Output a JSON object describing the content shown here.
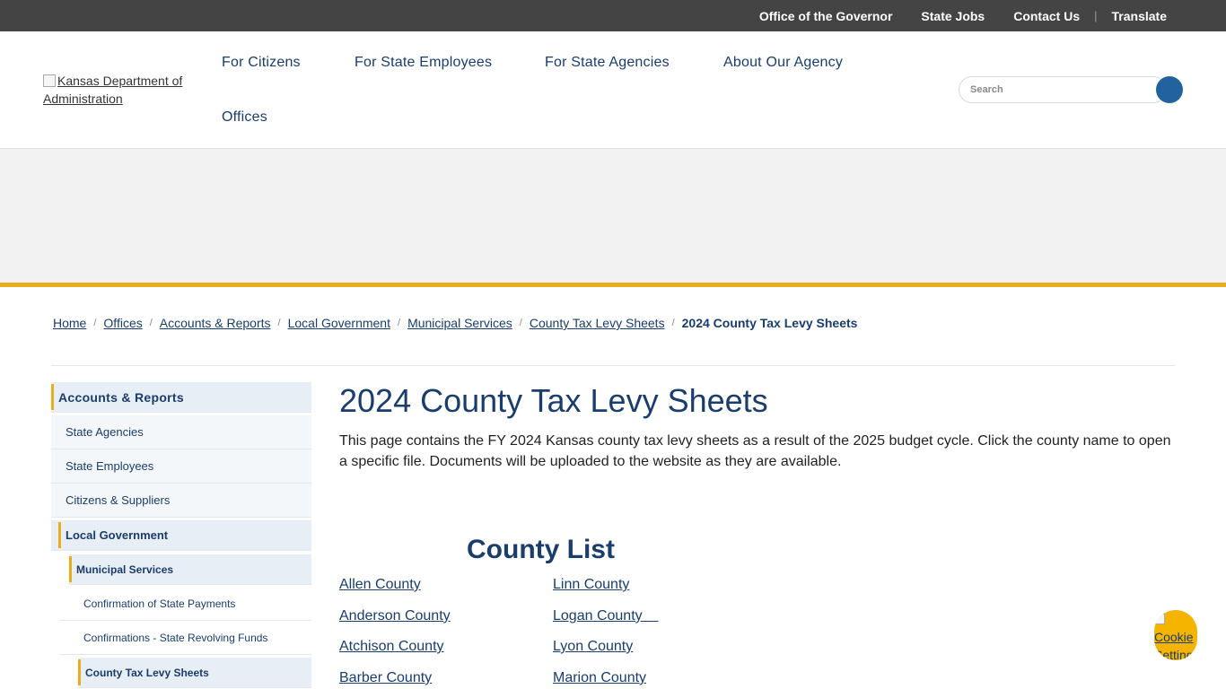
{
  "topbar": {
    "governor": "Office of the Governor",
    "jobs": "State Jobs",
    "contact": "Contact Us",
    "separator": "|",
    "translate": "Translate"
  },
  "header": {
    "logo_alt": "Kansas Department of Administration",
    "nav": {
      "citizens": "For Citizens",
      "employees": "For State Employees",
      "agencies": "For State Agencies",
      "about": "About Our Agency",
      "offices": "Offices"
    },
    "search_placeholder": "Search"
  },
  "breadcrumb": {
    "home": "Home",
    "offices": "Offices",
    "accounts": "Accounts & Reports",
    "local": "Local Government",
    "municipal": "Municipal Services",
    "levy": "County Tax Levy Sheets",
    "current": "2024 County Tax Levy Sheets",
    "sep": "/"
  },
  "sidebar": {
    "accounts": "Accounts & Reports",
    "state_agencies": "State Agencies",
    "state_employees": "State Employees",
    "citizens_suppliers": "Citizens & Suppliers",
    "local_government": "Local Government",
    "municipal_services": "Municipal Services",
    "confirmation_payments": "Confirmation of State Payments",
    "confirmations_funds": "Confirmations - State Revolving Funds",
    "county_levy": "County Tax Levy Sheets"
  },
  "main": {
    "title": "2024 County Tax Levy Sheets",
    "intro": "This page contains the FY 2024 Kansas county tax levy sheets as a result of the 2025 budget cycle. Click the county name to open a specific file. Documents will be uploaded to the website as they are available.",
    "county_list_heading": "County List",
    "counties": {
      "allen": "Allen County",
      "anderson": "Anderson County",
      "atchison": "Atchison County",
      "barber": "Barber County",
      "linn": "Linn County",
      "logan": "Logan County    ",
      "lyon": "Lyon County",
      "marion": "Marion County"
    }
  },
  "cookie": {
    "label": "Cookie Settings"
  },
  "colors": {
    "topbar": "#444444",
    "navy": "#1a3d6b",
    "accent_gold": "#eaab1f",
    "search_button": "#22639e",
    "cookie_button": "#f4b400"
  }
}
